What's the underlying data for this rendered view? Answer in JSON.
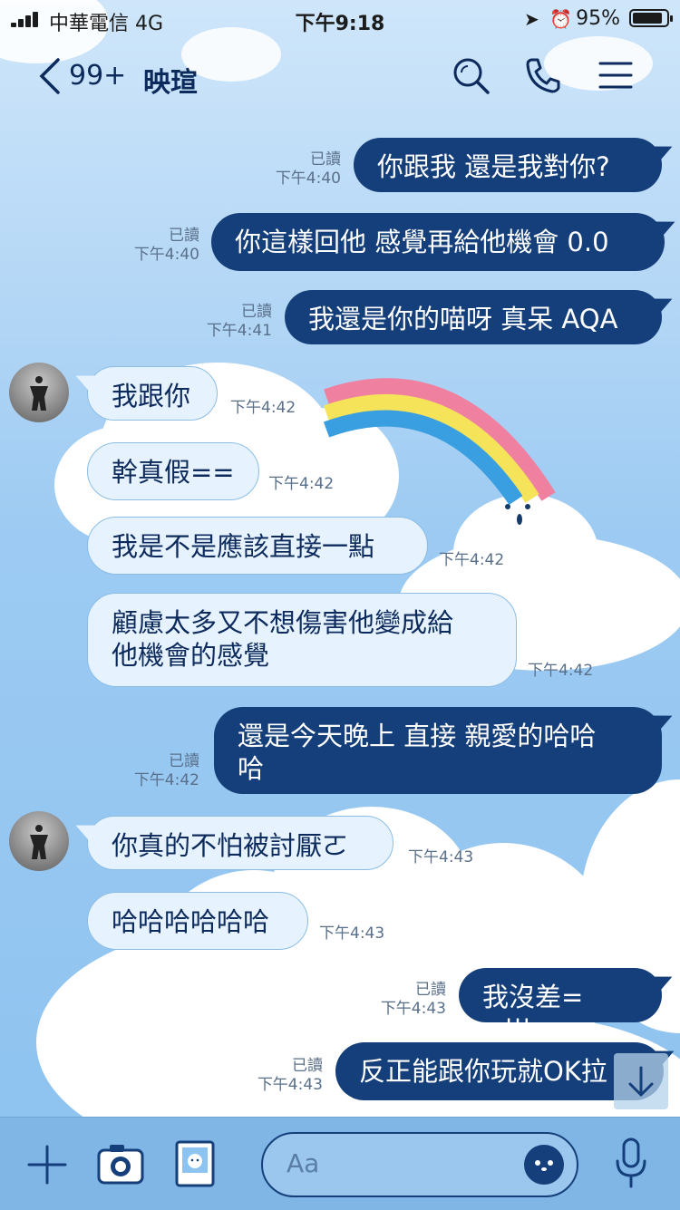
{
  "status": {
    "carrier": "中華電信 4G",
    "time": "下午9:18",
    "battery": "95%"
  },
  "header": {
    "unread_count": "99+",
    "contact_name": "映瑄"
  },
  "messages": [
    {
      "dir": "out",
      "text": "你跟我  還是我對你?",
      "read": "已讀",
      "time": "下午4:40"
    },
    {
      "dir": "out",
      "text": "你這樣回他 感覺再給他機會 0.0",
      "read": "已讀",
      "time": "下午4:40"
    },
    {
      "dir": "out",
      "text": "我還是你的喵呀 真呆 AQA",
      "read": "已讀",
      "time": "下午4:41"
    },
    {
      "dir": "in",
      "text": "我跟你",
      "time": "下午4:42"
    },
    {
      "dir": "in",
      "text": "幹真假==",
      "time": "下午4:42"
    },
    {
      "dir": "in",
      "text": "我是不是應該直接一點",
      "time": "下午4:42"
    },
    {
      "dir": "in",
      "text": "顧慮太多又不想傷害他變成給\n他機會的感覺",
      "time": "下午4:42"
    },
    {
      "dir": "out",
      "text": "還是今天晚上 直接  親愛的哈哈\n哈",
      "read": "已讀",
      "time": "下午4:42"
    },
    {
      "dir": "in",
      "text": "你真的不怕被討厭ㄛ",
      "time": "下午4:43"
    },
    {
      "dir": "in",
      "text": "哈哈哈哈哈哈",
      "time": "下午4:43"
    },
    {
      "dir": "out",
      "text": "我沒差= =|||",
      "read": "已讀",
      "time": "下午4:43"
    },
    {
      "dir": "out",
      "text": "反正能跟你玩就OK拉",
      "read": "已讀",
      "time": "下午4:43"
    }
  ],
  "footer": {
    "input_placeholder": "Aa"
  },
  "colors": {
    "outgoing_bubble": "#153f7a",
    "incoming_bubble": "#e6f3ff",
    "footer": "#7fb6e6"
  }
}
